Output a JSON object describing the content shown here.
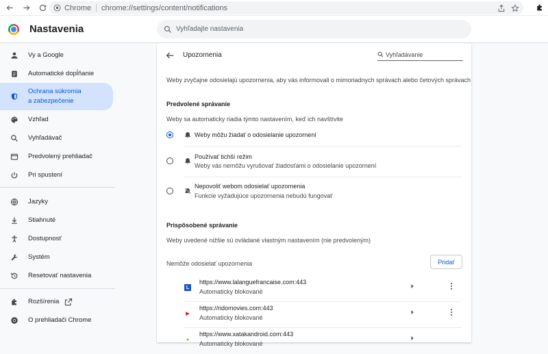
{
  "browser": {
    "site_label": "Chrome",
    "url": "chrome://settings/content/notifications"
  },
  "header": {
    "title": "Nastavenia",
    "search_placeholder": "Vyhľadajte nastavenia"
  },
  "sidebar": {
    "items": [
      {
        "label": "Vy a Google",
        "icon": "person-icon"
      },
      {
        "label": "Automatické dopĺňanie",
        "icon": "autofill-icon"
      },
      {
        "label": "Ochrana súkromia",
        "label2": "a zabezpečenie",
        "icon": "shield-icon",
        "active": true
      },
      {
        "label": "Vzhľad",
        "icon": "palette-icon"
      },
      {
        "label": "Vyhľadávač",
        "icon": "search-icon"
      },
      {
        "label": "Predvolený prehliadač",
        "icon": "browser-icon"
      },
      {
        "label": "Pri spustení",
        "icon": "power-icon"
      },
      {
        "label": "Jazyky",
        "icon": "globe-icon"
      },
      {
        "label": "Stiahnuté",
        "icon": "download-icon"
      },
      {
        "label": "Dostupnosť",
        "icon": "accessibility-icon"
      },
      {
        "label": "Systém",
        "icon": "wrench-icon"
      },
      {
        "label": "Resetovať nastavenia",
        "icon": "reset-icon"
      },
      {
        "label": "Rozšírenia",
        "icon": "puzzle-icon"
      },
      {
        "label": "O prehliadači Chrome",
        "icon": "chrome-icon"
      }
    ]
  },
  "page": {
    "title": "Upozornenia",
    "search_placeholder": "Vyhľadávanie",
    "intro": "Weby zvyčajne odosielajú upozornenia, aby vás informovali o mimoriadnych správach alebo četových správach",
    "default_section": "Predvolené správanie",
    "default_desc": "Weby sa automaticky riadia týmto nastavením, keď ich navštívite",
    "options": [
      {
        "title": "Weby môžu žiadať o odosielanie upozornení",
        "sub": "",
        "selected": true,
        "icon": "bell-icon"
      },
      {
        "title": "Používať tichší režim",
        "sub": "Weby vás nemôžu vyrušovať žiadosťami o odosielanie upozornení",
        "selected": false,
        "icon": "bell-icon"
      },
      {
        "title": "Nepovoliť webom odosielať upozornenia",
        "sub": "Funkcie vyžadujúce upozornenia nebudú fungovať",
        "selected": false,
        "icon": "bell-off-icon"
      }
    ],
    "custom_section": "Prispôsobené správanie",
    "custom_desc": "Weby uvedené nižšie sú ovládané vlastným nastavením (nie predvoleným)",
    "blocked_header": "Nemôže odosielať upozornenia",
    "add_label": "Pridať",
    "sites": [
      {
        "url": "https://www.lalanguefrancaise.com:443",
        "status": "Automaticky blokované",
        "fav_color": "#1a56c4",
        "fav_text": "L"
      },
      {
        "url": "https://ridomovies.com:443",
        "status": "Automaticky blokované",
        "fav_color": "#c62828",
        "fav_text": "▶"
      },
      {
        "url": "https://www.xatakandroid.com:443",
        "status": "Automaticky blokované",
        "fav_color": "#7cb342",
        "fav_text": "●"
      }
    ]
  }
}
